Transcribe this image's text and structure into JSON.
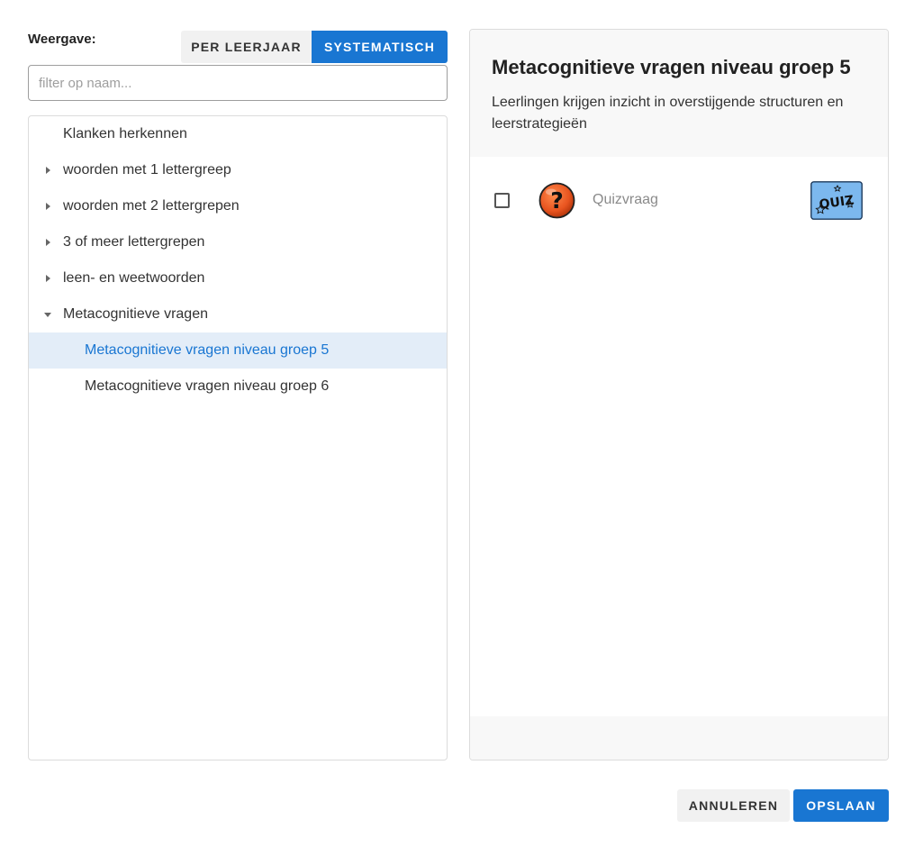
{
  "view": {
    "label": "Weergave:",
    "options": [
      "PER LEERJAAR",
      "SYSTEMATISCH"
    ],
    "selected": "SYSTEMATISCH"
  },
  "filter": {
    "placeholder": "filter op naam...",
    "value": ""
  },
  "tree": {
    "items": [
      {
        "label": "Klanken herkennen",
        "level": 0,
        "caret": "none"
      },
      {
        "label": "woorden met 1 lettergreep",
        "level": 0,
        "caret": "collapsed"
      },
      {
        "label": "woorden met 2 lettergrepen",
        "level": 0,
        "caret": "collapsed"
      },
      {
        "label": "3 of meer lettergrepen",
        "level": 0,
        "caret": "collapsed"
      },
      {
        "label": "leen- en weetwoorden",
        "level": 0,
        "caret": "collapsed"
      },
      {
        "label": "Metacognitieve vragen",
        "level": 0,
        "caret": "expanded"
      },
      {
        "label": "Metacognitieve vragen niveau groep 5",
        "level": 1,
        "caret": "none",
        "selected": true
      },
      {
        "label": "Metacognitieve vragen niveau groep 6",
        "level": 1,
        "caret": "none"
      }
    ]
  },
  "detail": {
    "title": "Metacognitieve vragen niveau groep 5",
    "description": "Leerlingen krijgen inzicht in overstijgende structuren en leerstrategieën",
    "content": [
      {
        "label": "Quizvraag",
        "icon": "question-icon",
        "badge": "quiz-badge-icon",
        "checked": false
      }
    ]
  },
  "actions": {
    "cancel": "ANNULEREN",
    "save": "OPSLAAN"
  },
  "colors": {
    "primary": "#1976d2",
    "selected_bg": "#e3edf8",
    "icon_orange": "#e8541f",
    "badge_blue": "#7cb8ee"
  }
}
